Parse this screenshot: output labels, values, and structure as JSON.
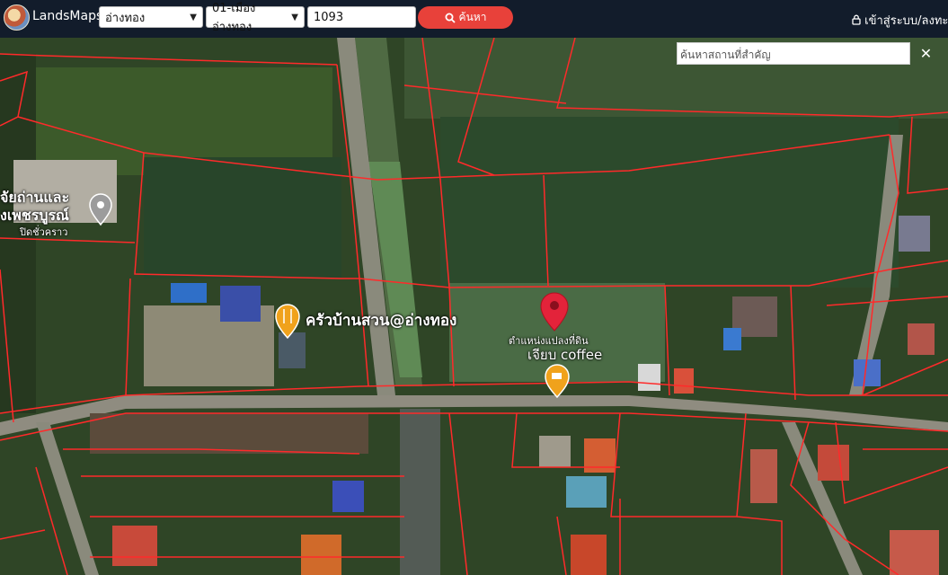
{
  "header": {
    "brand": "LandsMaps",
    "province_select": "อ่างทอง",
    "district_select": "01-เมืองอ่างทอง",
    "parcel_number": "1093",
    "search_button": "ค้นหา",
    "login_link": "เข้าสู่ระบบ/ลงทะเบี"
  },
  "map": {
    "landmark_search_placeholder": "ค้นหาสถานที่สำคัญ",
    "close_symbol": "✕",
    "labels": {
      "restaurant": "ครัวบ้านสวน@อ่างทอง",
      "parcel_marker": "ตำแหน่งแปลงที่ดิน",
      "coffee": "เจียบ coffee",
      "poi_left_line1": "จัยถ่านและ",
      "poi_left_line2": "งเพชรบูรณ์",
      "poi_left_line3": "ปิดชั่วคราว"
    },
    "colors": {
      "parcel_lines": "#ff2a2a",
      "marker": "#e3233a",
      "poi_orange": "#f0a21c"
    }
  }
}
